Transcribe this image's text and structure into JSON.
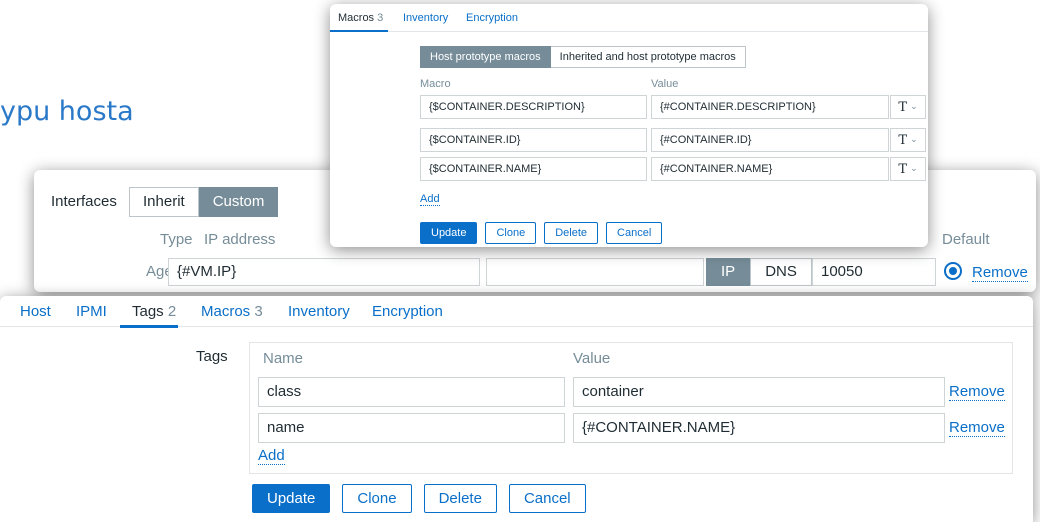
{
  "heading": "ypu hosta",
  "macros_card": {
    "tabs": [
      {
        "label": "Macros",
        "count": "3"
      },
      {
        "label": "Inventory"
      },
      {
        "label": "Encryption"
      }
    ],
    "segments": [
      "Host prototype macros",
      "Inherited and host prototype macros"
    ],
    "col_macro": "Macro",
    "col_value": "Value",
    "rows": [
      {
        "macro": "{$CONTAINER.DESCRIPTION}",
        "value": "{#CONTAINER.DESCRIPTION}",
        "type_glyph": "T"
      },
      {
        "macro": "{$CONTAINER.ID}",
        "value": "{#CONTAINER.ID}",
        "type_glyph": "T"
      },
      {
        "macro": "{$CONTAINER.NAME}",
        "value": "{#CONTAINER.NAME}",
        "type_glyph": "T"
      }
    ],
    "add_label": "Add",
    "buttons": {
      "update": "Update",
      "clone": "Clone",
      "delete": "Delete",
      "cancel": "Cancel"
    }
  },
  "interfaces_card": {
    "label": "Interfaces",
    "mode_options": [
      "Inherit",
      "Custom"
    ],
    "selected_mode": "Custom",
    "col_type": "Type",
    "col_ip": "IP address",
    "col_default": "Default",
    "agent_label": "Agent",
    "ip_value": "{#VM.IP}",
    "connect_options": [
      "IP",
      "DNS"
    ],
    "port_value": "10050",
    "remove_label": "Remove"
  },
  "tags_card": {
    "tabs": [
      {
        "label": "Host"
      },
      {
        "label": "IPMI"
      },
      {
        "label": "Tags",
        "count": "2"
      },
      {
        "label": "Macros",
        "count": "3"
      },
      {
        "label": "Inventory"
      },
      {
        "label": "Encryption"
      }
    ],
    "tags_label": "Tags",
    "col_name": "Name",
    "col_value": "Value",
    "rows": [
      {
        "name": "class",
        "value": "container",
        "remove": "Remove"
      },
      {
        "name": "name",
        "value": "{#CONTAINER.NAME}",
        "remove": "Remove"
      }
    ],
    "add_label": "Add",
    "buttons": {
      "update": "Update",
      "clone": "Clone",
      "delete": "Delete",
      "cancel": "Cancel"
    }
  },
  "colors": {
    "accent": "#0a6fc8",
    "segment_active": "#768d99",
    "heading": "#2a79c9"
  }
}
